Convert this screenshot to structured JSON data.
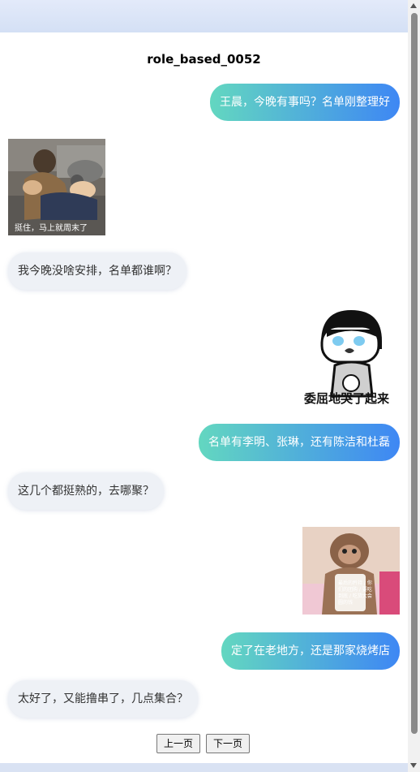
{
  "chat": {
    "title": "role_based_0052",
    "messages": [
      {
        "side": "right",
        "text": "王晨，今晚有事吗？名单刚整理好"
      },
      {
        "side": "left",
        "sticker": "running-man-meme",
        "caption": "挺住，马上就周末了"
      },
      {
        "side": "left",
        "text": "我今晚没啥安排，名单都谁啊？"
      },
      {
        "side": "right",
        "sticker": "crying-cartoon-meme",
        "caption": "委屈地哭了起来"
      },
      {
        "side": "right",
        "text": "名单有李明、张琳，还有陈洁和杜磊"
      },
      {
        "side": "left",
        "text": "这几个都挺熟的，去哪聚？"
      },
      {
        "side": "right",
        "sticker": "monkey-meme",
        "caption": "最后的矜持 / 你们的团购 / 要吃到底 / 吃货大会圆的钱"
      },
      {
        "side": "right",
        "text": "定了在老地方，还是那家烧烤店"
      },
      {
        "side": "left",
        "text": "太好了，又能撸串了，几点集合？"
      }
    ]
  },
  "pager": {
    "prev_label": "上一页",
    "next_label": "下一页"
  },
  "colors": {
    "bubble_gradient_start": "#63d7c0",
    "bubble_gradient_end": "#3e87f4",
    "left_bubble": "#eef1f6"
  }
}
